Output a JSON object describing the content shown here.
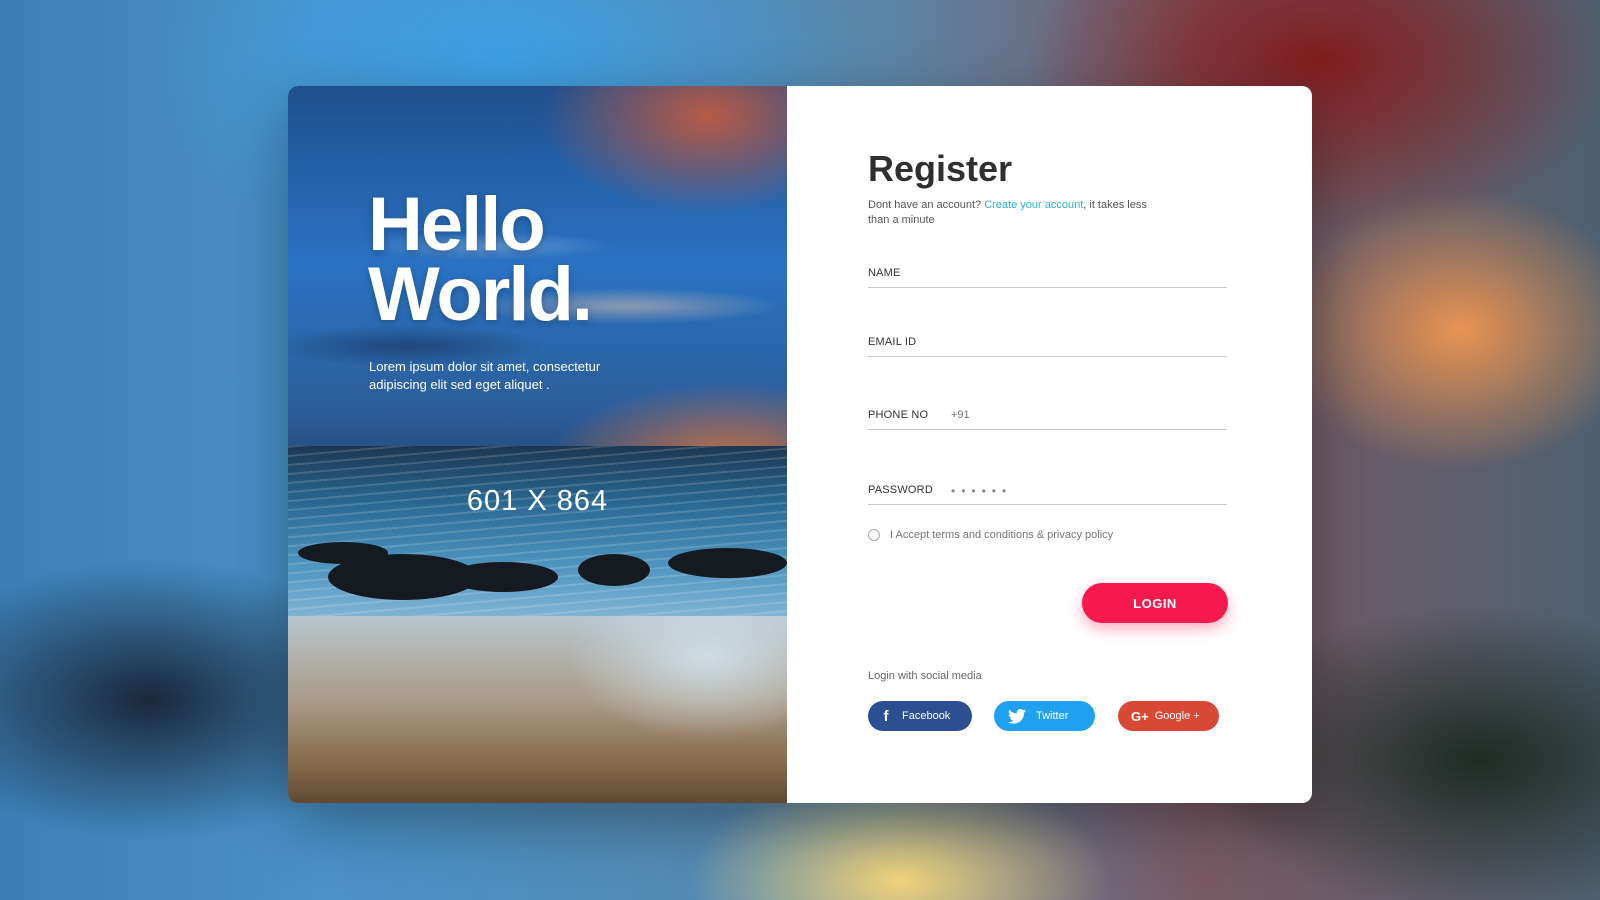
{
  "hero": {
    "heading_line1": "Hello",
    "heading_line2": "World.",
    "description": "Lorem ipsum dolor sit amet, consectetur adipiscing elit sed eget aliquet .",
    "image_dimension_label": "601 X 864"
  },
  "form": {
    "title": "Register",
    "subtitle_prefix": "Dont have an account? ",
    "subtitle_link": "Create your account",
    "subtitle_suffix": ", it takes less than a minute",
    "fields": {
      "name_label": "NAME",
      "email_label": "EMAIL ID",
      "phone_label": "PHONE NO",
      "phone_prefix": "+91",
      "password_label": "PASSWORD",
      "password_value": "••••••"
    },
    "terms_label": "I Accept terms and conditions & privacy policy",
    "login_button": "LOGIN",
    "social_label": "Login with social media",
    "social": {
      "facebook": "Facebook",
      "twitter": "Twitter",
      "google": "Google +"
    }
  },
  "colors": {
    "accent": "#f5194c",
    "link": "#2ab3c9",
    "facebook": "#2c4f93",
    "twitter": "#1ea1ef",
    "google": "#d94834"
  },
  "icons": [
    "facebook-icon",
    "twitter-icon",
    "google-plus-icon",
    "radio-icon"
  ]
}
